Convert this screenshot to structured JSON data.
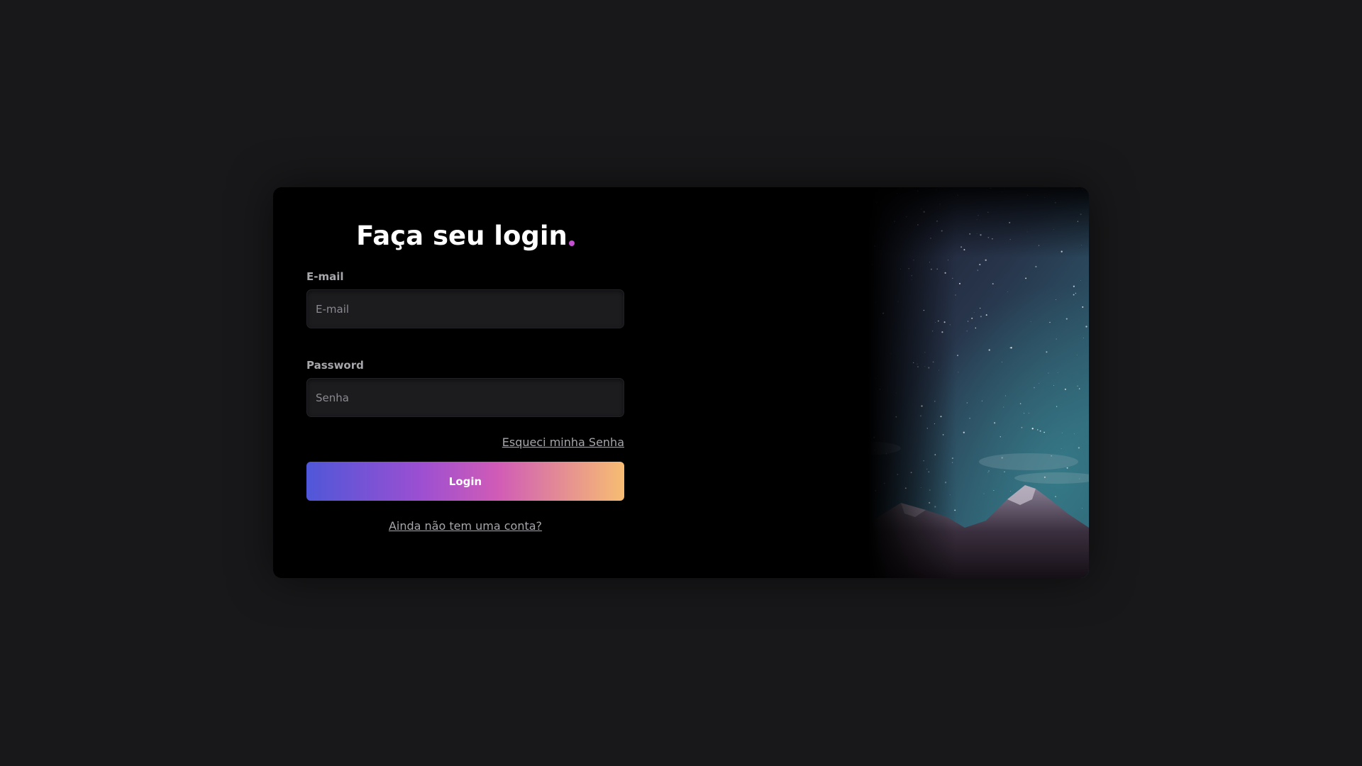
{
  "login": {
    "title": "Faça seu login",
    "email_label": "E-mail",
    "email_placeholder": "E-mail",
    "email_value": "",
    "password_label": "Password",
    "password_placeholder": "Senha",
    "password_value": "",
    "forgot_label": "Esqueci minha Senha",
    "submit_label": "Login",
    "signup_label": "Ainda não tem uma conta?"
  },
  "colors": {
    "accent_dot": "#c44fd1",
    "button_gradient": [
      "#4f57d8",
      "#9a4fd2",
      "#d05bb7",
      "#f7bd72"
    ],
    "page_background": "#18181a",
    "card_background": "#000000"
  },
  "background_image": {
    "subject": "starry-night-mountain-photo"
  }
}
